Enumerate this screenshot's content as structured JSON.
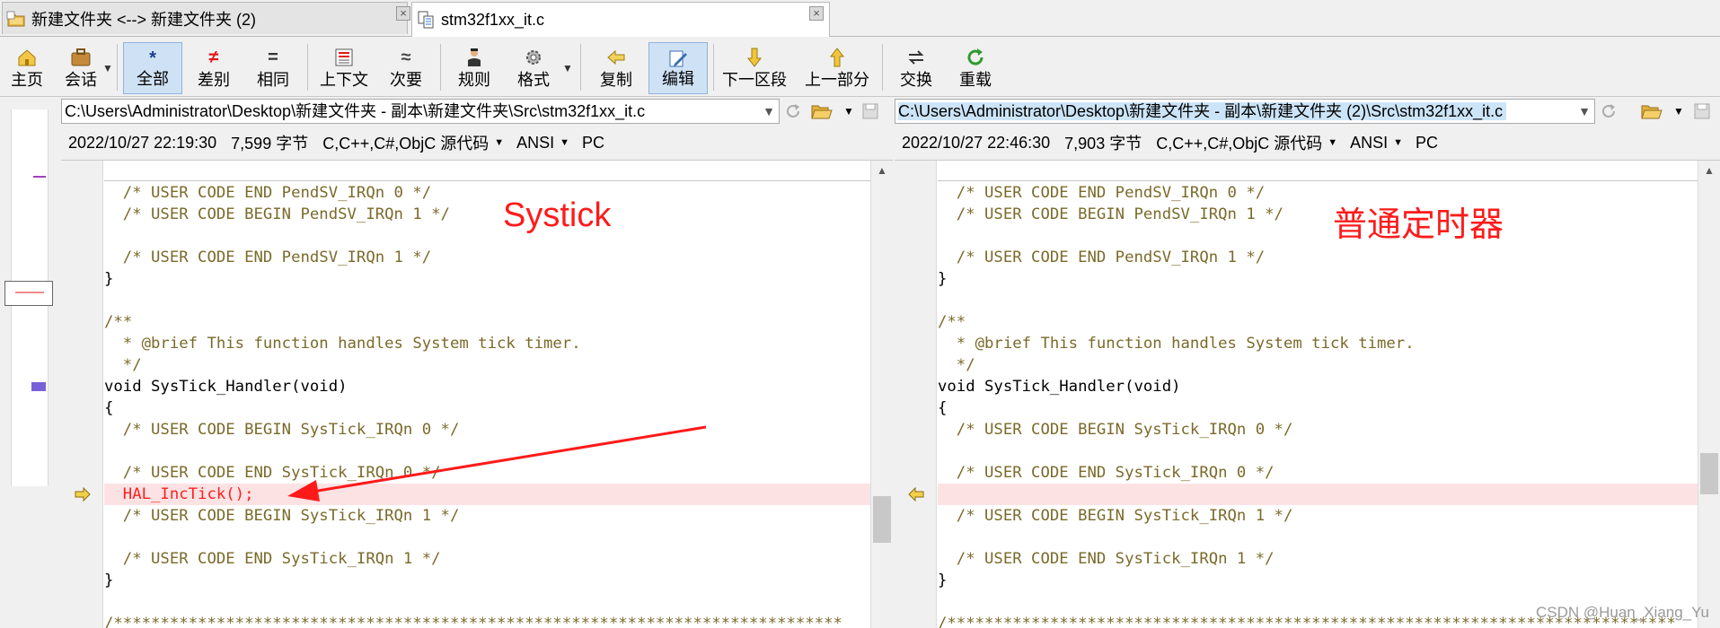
{
  "tabs": [
    {
      "label": "新建文件夹 <--> 新建文件夹 (2)",
      "icon": "folder-compare-icon"
    },
    {
      "label": "stm32f1xx_it.c",
      "icon": "text-compare-icon"
    }
  ],
  "toolbar": {
    "home": "主页",
    "session": "会话",
    "all": "全部",
    "diff": "差别",
    "same": "相同",
    "context": "上下文",
    "minor": "次要",
    "rules": "规则",
    "format": "格式",
    "copy": "复制",
    "edit": "编辑",
    "next_section": "下一区段",
    "prev_section": "上一部分",
    "swap": "交换",
    "reload": "重载"
  },
  "left": {
    "path": "C:\\Users\\Administrator\\Desktop\\新建文件夹 - 副本\\新建文件夹\\Src\\stm32f1xx_it.c",
    "date": "2022/10/27 22:19:30",
    "size": "7,599 字节",
    "lang": "C,C++,C#,ObjC 源代码",
    "encoding": "ANSI",
    "lineend": "PC",
    "annotation": "Systick"
  },
  "right": {
    "path": "C:\\Users\\Administrator\\Desktop\\新建文件夹 - 副本\\新建文件夹 (2)\\Src\\stm32f1xx_it.c",
    "date": "2022/10/27 22:46:30",
    "size": "7,903 字节",
    "lang": "C,C++,C#,ObjC 源代码",
    "encoding": "ANSI",
    "lineend": "PC",
    "annotation": "普通定时器"
  },
  "code_left": [
    "  /* USER CODE END PendSV_IRQn 0 */",
    "  /* USER CODE BEGIN PendSV_IRQn 1 */",
    "",
    "  /* USER CODE END PendSV_IRQn 1 */",
    "}",
    "",
    "/**",
    "  * @brief This function handles System tick timer.",
    "  */",
    "void SysTick_Handler(void)",
    "{",
    "  /* USER CODE BEGIN SysTick_IRQn 0 */",
    "",
    "  /* USER CODE END SysTick_IRQn 0 */",
    "  HAL_IncTick();",
    "  /* USER CODE BEGIN SysTick_IRQn 1 */",
    "",
    "  /* USER CODE END SysTick_IRQn 1 */",
    "}",
    "",
    "/******************************************************************************"
  ],
  "code_right": [
    "  /* USER CODE END PendSV_IRQn 0 */",
    "  /* USER CODE BEGIN PendSV_IRQn 1 */",
    "",
    "  /* USER CODE END PendSV_IRQn 1 */",
    "}",
    "",
    "/**",
    "  * @brief This function handles System tick timer.",
    "  */",
    "void SysTick_Handler(void)",
    "{",
    "  /* USER CODE BEGIN SysTick_IRQn 0 */",
    "",
    "  /* USER CODE END SysTick_IRQn 0 */",
    "",
    "  /* USER CODE BEGIN SysTick_IRQn 1 */",
    "",
    "  /* USER CODE END SysTick_IRQn 1 */",
    "}",
    "",
    "/******************************************************************************"
  ],
  "diff_line_index": 14,
  "watermark": "CSDN @Huan_Xiang_Yu",
  "colors": {
    "diff_bg": "#fde2e4",
    "comment": "#7a6a2a",
    "annotation": "#ff1a1a",
    "pressed": "#cfe2f5"
  }
}
